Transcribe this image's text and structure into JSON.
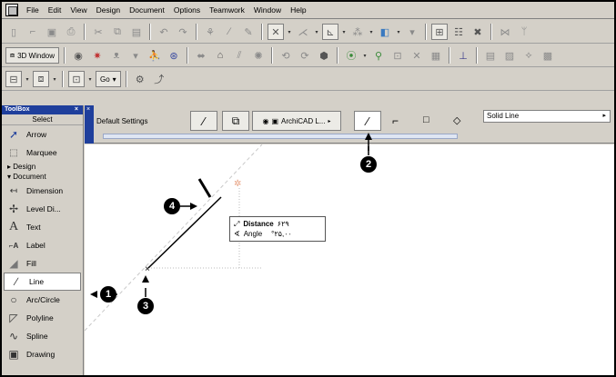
{
  "menu": [
    "File",
    "Edit",
    "View",
    "Design",
    "Document",
    "Options",
    "Teamwork",
    "Window",
    "Help"
  ],
  "toolbar2": {
    "window_label": "3D Window"
  },
  "toolbar3": {
    "go_label": "Go"
  },
  "toolbox": {
    "title": "ToolBox",
    "close": "×",
    "select_label": "Select",
    "tools_top": [
      {
        "label": "Arrow",
        "icon": "arrow-cursor-icon"
      },
      {
        "label": "Marquee",
        "icon": "marquee-icon"
      }
    ],
    "group_design": "Design",
    "group_document": "Document",
    "tools": [
      {
        "label": "Dimension",
        "icon": "dimension-icon"
      },
      {
        "label": "Level Di...",
        "icon": "level-dimension-icon"
      },
      {
        "label": "Text",
        "icon": "text-icon"
      },
      {
        "label": "Label",
        "icon": "label-icon"
      },
      {
        "label": "Fill",
        "icon": "fill-icon"
      },
      {
        "label": "Line",
        "icon": "line-icon",
        "selected": true
      },
      {
        "label": "Arc/Circle",
        "icon": "arc-circle-icon"
      },
      {
        "label": "Polyline",
        "icon": "polyline-icon"
      },
      {
        "label": "Spline",
        "icon": "spline-icon"
      },
      {
        "label": "Drawing",
        "icon": "drawing-icon"
      }
    ]
  },
  "infobox": {
    "side_close": "×",
    "default_settings": "Default Settings",
    "layer_label": "ArchiCAD L...",
    "line_type": "Solid Line"
  },
  "tracker": {
    "distance_label": "Distance",
    "distance_value": "۶۲۹",
    "angle_label": "Angle",
    "angle_value": "°۲۵,۰۰"
  },
  "callouts": [
    "1",
    "2",
    "3",
    "4"
  ],
  "colors": {
    "toolbox_title_bg": "#1f3f9c",
    "chrome": "#d4d0c8",
    "snap_point": "#e8a080"
  }
}
